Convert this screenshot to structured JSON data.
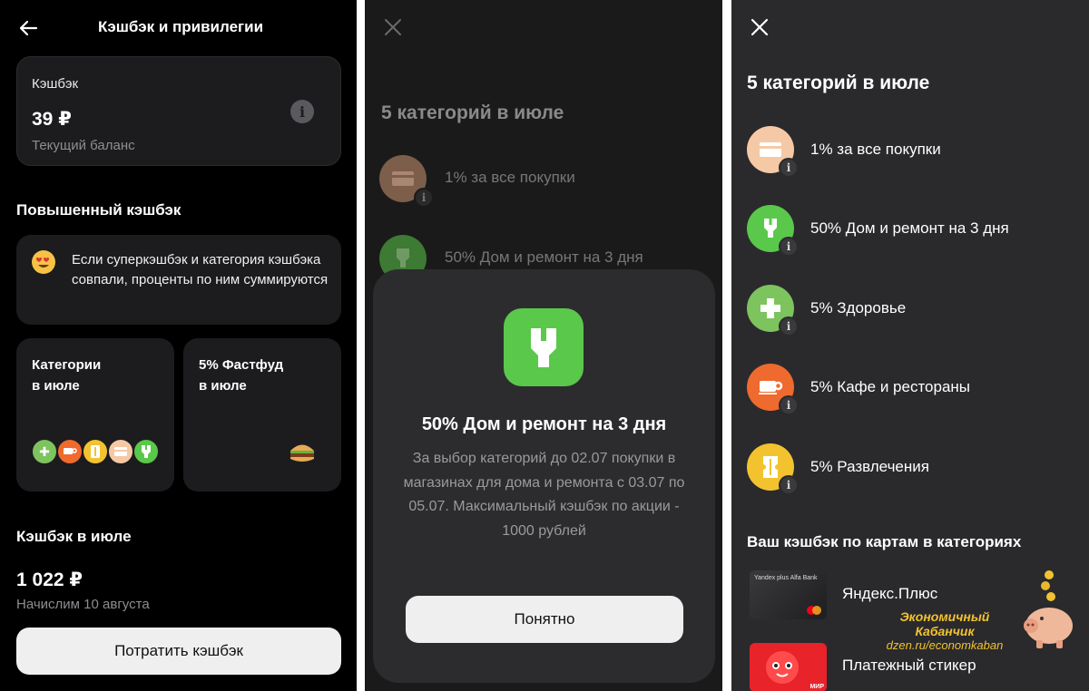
{
  "colors": {
    "green": "#5ac84a",
    "peach": "#f5c9a6",
    "orange": "#ef6a2e",
    "yellow": "#f2c32f",
    "light_green": "#7dc35e"
  },
  "panel1": {
    "title": "Кэшбэк и привилегии",
    "balance": {
      "label": "Кэшбэк",
      "amount": "39 ₽",
      "sub": "Текущий баланс"
    },
    "raised_title": "Повышенный кэшбэк",
    "note": "Если суперкэшбэк и категория кэшбэка совпали, проценты по ним суммируются",
    "cat_card": {
      "title": "Категории\nв июле"
    },
    "fastfood_card": {
      "title": "5% Фастфуд\nв июле"
    },
    "month_title": "Кэшбэк в июле",
    "month_amount": "1 022 ₽",
    "month_sub": "Начислим 10 августа",
    "spend_button": "Потратить кэшбэк"
  },
  "panel2": {
    "heading": "5 категорий в июле",
    "rows": [
      "1% за все покупки",
      "50% Дом и ремонт на 3 дня"
    ],
    "modal": {
      "title": "50% Дом и ремонт на 3 дня",
      "body": "За выбор категорий до 02.07 покупки в магазинах для дома и ремонта с 03.07 по 05.07. Максимальный кэшбэк по акции - 1000 рублей",
      "button": "Понятно"
    }
  },
  "panel3": {
    "heading": "5 категорий в июле",
    "categories": [
      {
        "label": "1% за все покупки",
        "icon": "card-icon"
      },
      {
        "label": "50% Дом и ремонт на 3 дня",
        "icon": "plug-icon"
      },
      {
        "label": "5% Здоровье",
        "icon": "cross-icon"
      },
      {
        "label": "5% Кафе и рестораны",
        "icon": "cup-icon"
      },
      {
        "label": "5% Развлечения",
        "icon": "ticket-icon"
      }
    ],
    "cards_title": "Ваш кэшбэк по картам в категориях",
    "cards": [
      {
        "name": "Яндекс.Плюс",
        "thumb_text": "Yandex plus  Alfa Bank"
      },
      {
        "name": "Платежный стикер",
        "thumb_text": "МИР"
      }
    ],
    "watermark": {
      "title": "Экономичный Кабанчик",
      "url": "dzen.ru/economkaban"
    }
  }
}
